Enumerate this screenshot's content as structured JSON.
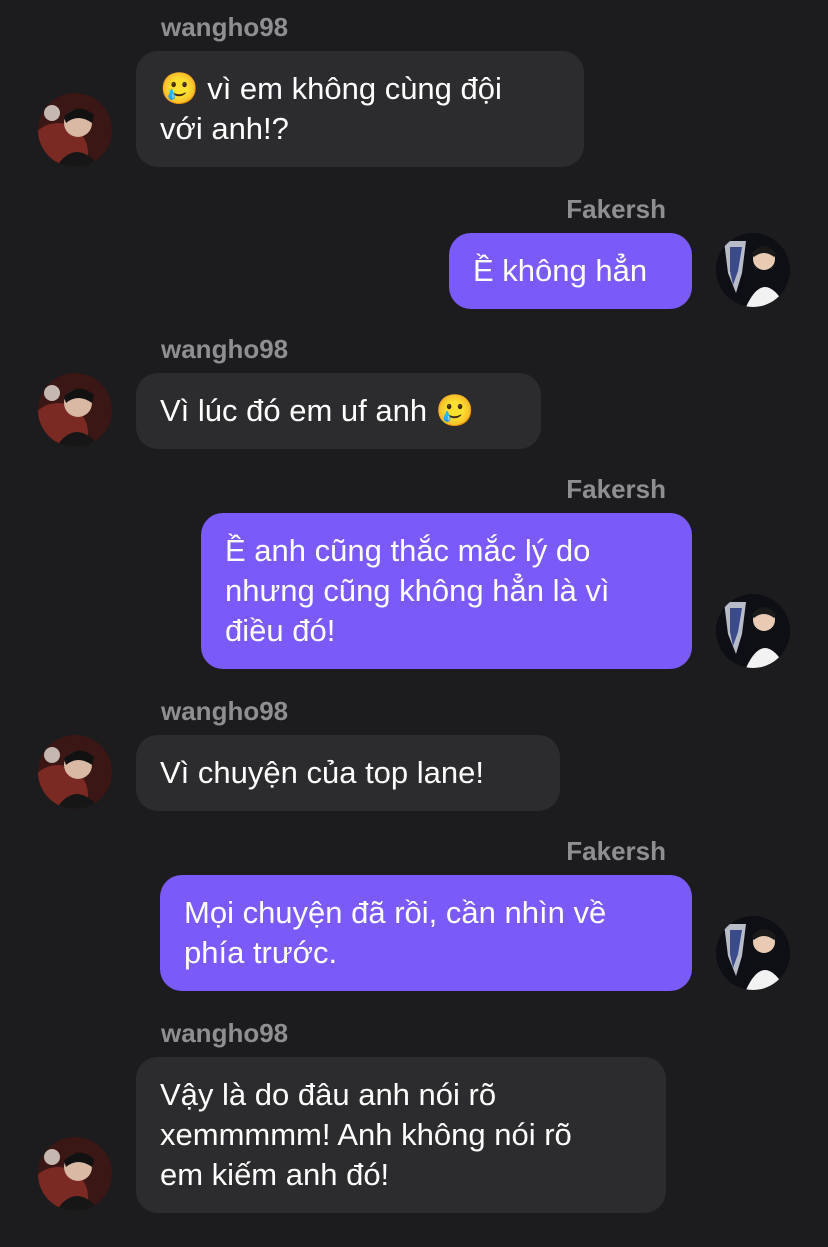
{
  "conversation": {
    "messages": [
      {
        "sender": "wangho98",
        "direction": "incoming",
        "text": "🥲 vì em không cùng đội\nvới anh!?"
      },
      {
        "sender": "Fakersh",
        "direction": "outgoing",
        "text": "Ề không hẳn"
      },
      {
        "sender": "wangho98",
        "direction": "incoming",
        "text": "Vì lúc đó em uf anh 🥲"
      },
      {
        "sender": "Fakersh",
        "direction": "outgoing",
        "text": "Ề anh cũng thắc mắc lý do\nnhưng cũng không hẳn là vì\nđiều đó!"
      },
      {
        "sender": "wangho98",
        "direction": "incoming",
        "text": "Vì chuyện của top lane!"
      },
      {
        "sender": "Fakersh",
        "direction": "outgoing",
        "text": "Mọi chuyện đã rồi, cần nhìn về\nphía trước."
      },
      {
        "sender": "wangho98",
        "direction": "incoming",
        "text": "Vậy là do đâu anh nói rõ\nxemmmmm! Anh không nói rõ\nem kiếm anh đó!"
      }
    ]
  },
  "colors": {
    "background": "#1c1c1e",
    "incoming_bubble": "#2c2c2e",
    "outgoing_bubble": "#7a5af8",
    "sender_name": "#8e8e93"
  },
  "avatars": {
    "incoming": "user-avatar-wangho98",
    "outgoing": "user-avatar-fakersh-trophy"
  }
}
